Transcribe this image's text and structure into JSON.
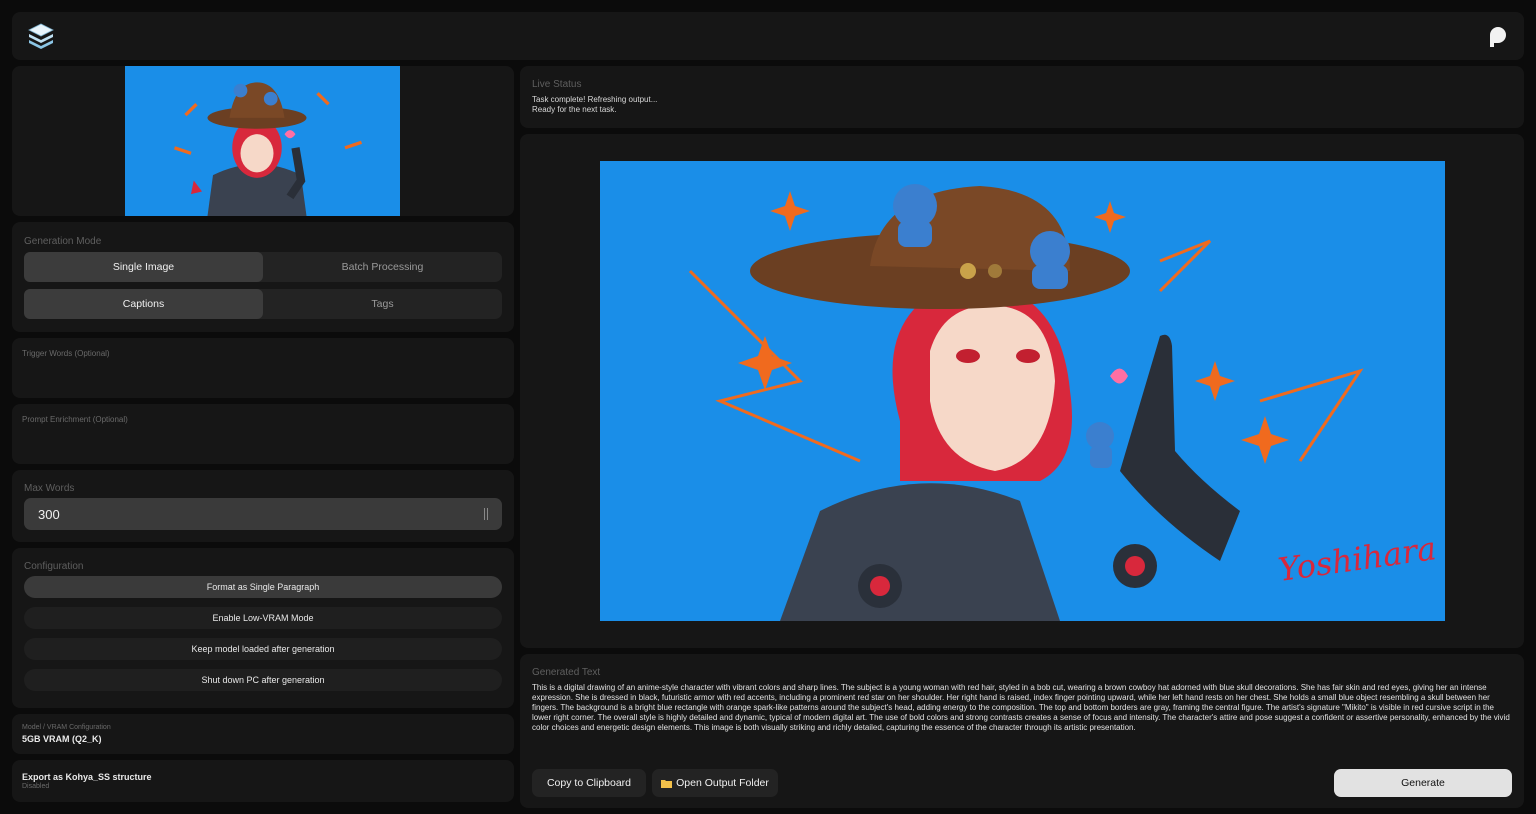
{
  "app": {
    "logo_icon": "layers-stack-icon",
    "profile_icon": "patreon-icon"
  },
  "sidebar": {
    "generation_mode": {
      "label": "Generation Mode",
      "modes": [
        "Single Image",
        "Batch Processing"
      ],
      "selected_mode": "Single Image",
      "outputs": [
        "Captions",
        "Tags"
      ],
      "selected_output": "Captions"
    },
    "trigger_words": {
      "label": "Trigger Words (Optional)",
      "value": ""
    },
    "prompt_enrichment": {
      "label": "Prompt Enrichment (Optional)",
      "value": ""
    },
    "max_words": {
      "label": "Max Words",
      "value": "300"
    },
    "configuration": {
      "label": "Configuration",
      "options": [
        {
          "label": "Format as Single Paragraph",
          "enabled": true
        },
        {
          "label": "Enable Low-VRAM Mode",
          "enabled": false
        },
        {
          "label": "Keep model loaded after generation",
          "enabled": false
        },
        {
          "label": "Shut down PC after generation",
          "enabled": false
        }
      ]
    },
    "model": {
      "label": "Model / VRAM Configuration",
      "value": "5GB VRAM (Q2_K)"
    },
    "export": {
      "label": "Export as Kohya_SS structure",
      "status": "Disabled"
    }
  },
  "status": {
    "label": "Live Status",
    "lines": [
      "Task complete! Refreshing output...",
      "Ready for the next task."
    ]
  },
  "preview": {
    "signature": "Yoshihara",
    "colors": {
      "background": "#1a8ee8",
      "hair": "#d8283c",
      "hat": "#6b3f22",
      "armor": "#3a4250",
      "accent": "#f06a1e"
    }
  },
  "output": {
    "label": "Generated Text",
    "text": "This is a digital drawing of an anime-style character with vibrant colors and sharp lines. The subject is a young woman with red hair, styled in a bob cut, wearing a brown cowboy hat adorned with blue skull decorations. She has fair skin and red eyes, giving her an intense expression. She is dressed in black, futuristic armor with red accents, including a prominent red star on her shoulder. Her right hand is raised, index finger pointing upward, while her left hand rests on her chest. She holds a small blue object resembling a skull between her fingers. The background is a bright blue rectangle with orange spark-like patterns around the subject's head, adding energy to the composition. The top and bottom borders are gray, framing the central figure. The artist's signature \"Mikito\" is visible in red cursive script in the lower right corner. The overall style is highly detailed and dynamic, typical of modern digital art. The use of bold colors and strong contrasts creates a sense of focus and intensity. The character's attire and pose suggest a confident or assertive personality, enhanced by the vivid color choices and energetic design elements. This image is both visually striking and richly detailed, capturing the essence of the character through its artistic presentation.",
    "copy_label": "Copy to Clipboard",
    "folder_label": "Open Output Folder",
    "folder_icon": "folder-icon",
    "generate_label": "Generate"
  }
}
